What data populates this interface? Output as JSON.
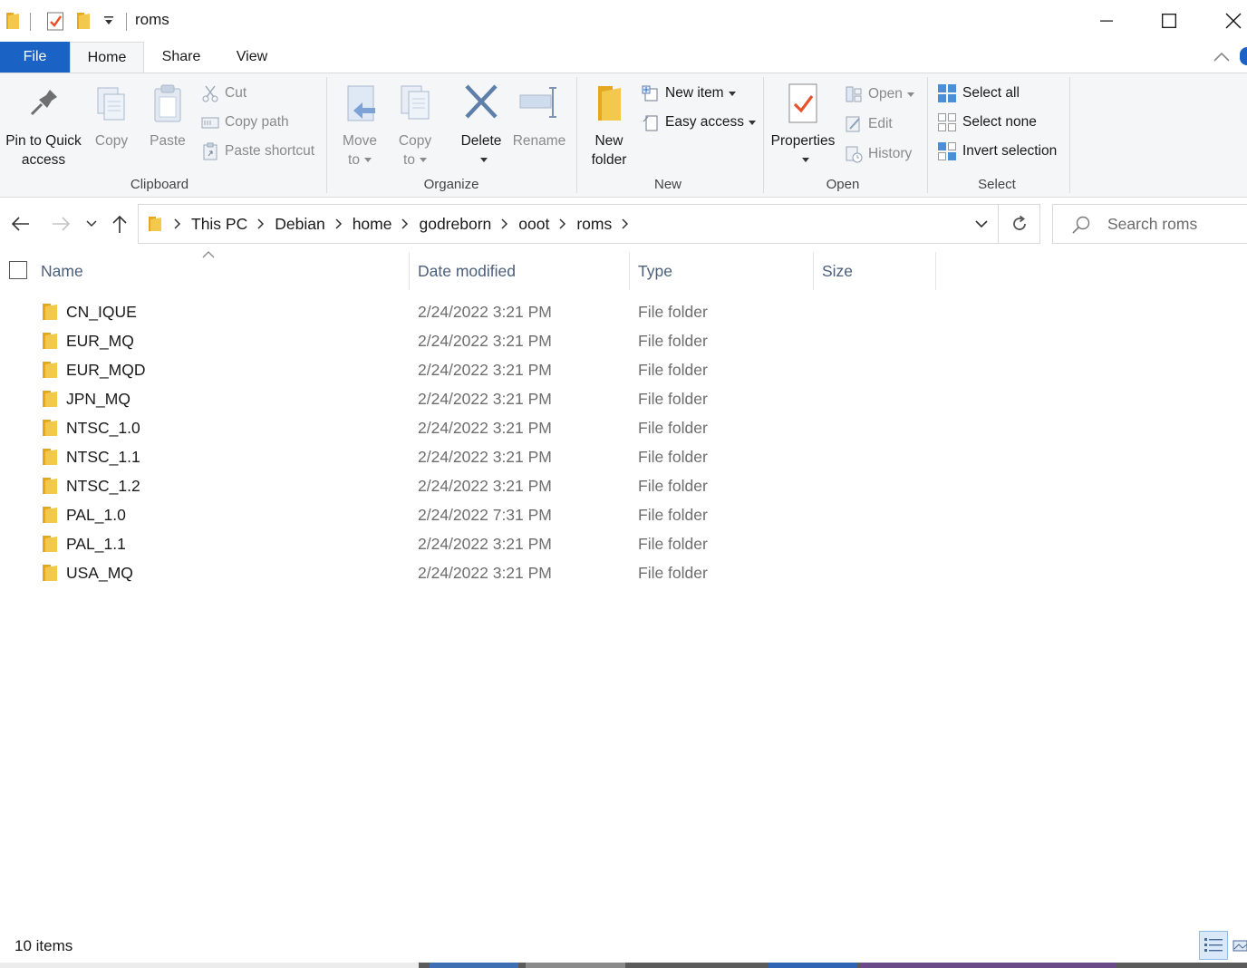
{
  "window": {
    "title": "roms"
  },
  "ribbon_tabs": [
    "File",
    "Home",
    "Share",
    "View"
  ],
  "clipboard": {
    "pin_label_1": "Pin to Quick",
    "pin_label_2": "access",
    "copy": "Copy",
    "paste": "Paste",
    "cut": "Cut",
    "copy_path": "Copy path",
    "paste_shortcut": "Paste shortcut",
    "group": "Clipboard"
  },
  "organize": {
    "move_to_1": "Move",
    "move_to_2": "to",
    "copy_to_1": "Copy",
    "copy_to_2": "to",
    "delete": "Delete",
    "rename": "Rename",
    "group": "Organize"
  },
  "new": {
    "new_folder_1": "New",
    "new_folder_2": "folder",
    "new_item": "New item",
    "easy_access": "Easy access",
    "group": "New"
  },
  "open": {
    "properties": "Properties",
    "open": "Open",
    "edit": "Edit",
    "history": "History",
    "group": "Open"
  },
  "select": {
    "select_all": "Select all",
    "select_none": "Select none",
    "invert_selection": "Invert selection",
    "group": "Select"
  },
  "address": {
    "crumbs": [
      "This PC",
      "Debian",
      "home",
      "godreborn",
      "ooot",
      "roms"
    ]
  },
  "search": {
    "placeholder": "Search roms"
  },
  "columns": {
    "name": "Name",
    "date": "Date modified",
    "type": "Type",
    "size": "Size"
  },
  "files": [
    {
      "name": "CN_IQUE",
      "date": "2/24/2022 3:21 PM",
      "type": "File folder",
      "size": ""
    },
    {
      "name": "EUR_MQ",
      "date": "2/24/2022 3:21 PM",
      "type": "File folder",
      "size": ""
    },
    {
      "name": "EUR_MQD",
      "date": "2/24/2022 3:21 PM",
      "type": "File folder",
      "size": ""
    },
    {
      "name": "JPN_MQ",
      "date": "2/24/2022 3:21 PM",
      "type": "File folder",
      "size": ""
    },
    {
      "name": "NTSC_1.0",
      "date": "2/24/2022 3:21 PM",
      "type": "File folder",
      "size": ""
    },
    {
      "name": "NTSC_1.1",
      "date": "2/24/2022 3:21 PM",
      "type": "File folder",
      "size": ""
    },
    {
      "name": "NTSC_1.2",
      "date": "2/24/2022 3:21 PM",
      "type": "File folder",
      "size": ""
    },
    {
      "name": "PAL_1.0",
      "date": "2/24/2022 7:31 PM",
      "type": "File folder",
      "size": ""
    },
    {
      "name": "PAL_1.1",
      "date": "2/24/2022 3:21 PM",
      "type": "File folder",
      "size": ""
    },
    {
      "name": "USA_MQ",
      "date": "2/24/2022 3:21 PM",
      "type": "File folder",
      "size": ""
    }
  ],
  "status": {
    "item_count": "10 items"
  },
  "colors": {
    "accent": "#1a63c4",
    "folder": "#f2c94c",
    "header_text": "#4c607a"
  }
}
